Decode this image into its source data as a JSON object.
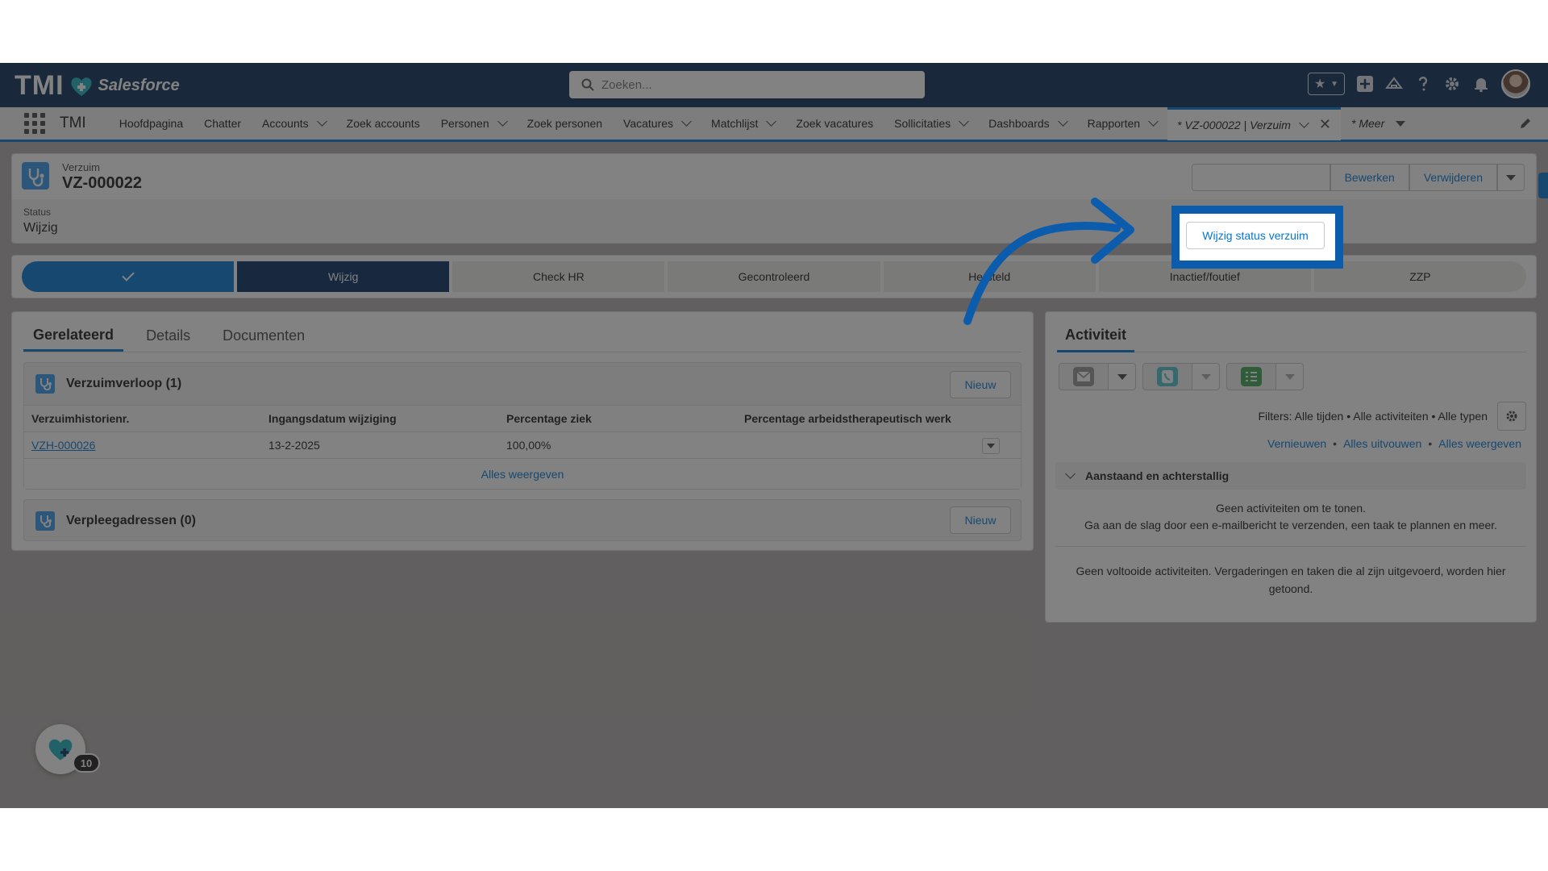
{
  "header": {
    "logo_text": "TMI",
    "brand_text": "Salesforce",
    "search_placeholder": "Zoeken..."
  },
  "nav": {
    "app_name": "TMI",
    "items": [
      {
        "label": "Hoofdpagina",
        "dropdown": false
      },
      {
        "label": "Chatter",
        "dropdown": false
      },
      {
        "label": "Accounts",
        "dropdown": true
      },
      {
        "label": "Zoek accounts",
        "dropdown": false
      },
      {
        "label": "Personen",
        "dropdown": true
      },
      {
        "label": "Zoek personen",
        "dropdown": false
      },
      {
        "label": "Vacatures",
        "dropdown": true
      },
      {
        "label": "Matchlijst",
        "dropdown": true
      },
      {
        "label": "Zoek vacatures",
        "dropdown": false
      },
      {
        "label": "Sollicitaties",
        "dropdown": true
      },
      {
        "label": "Dashboards",
        "dropdown": true
      },
      {
        "label": "Rapporten",
        "dropdown": true
      }
    ],
    "active_tab": "* VZ-000022 | Verzuim",
    "more_label": "* Meer"
  },
  "record": {
    "object_type": "Verzuim",
    "name": "VZ-000022",
    "status_label": "Status",
    "status_value": "Wijzig",
    "buttons": {
      "change_status": "Wijzig status verzuim",
      "edit": "Bewerken",
      "delete": "Verwijderen"
    }
  },
  "path": {
    "steps": [
      {
        "label": "",
        "state": "done"
      },
      {
        "label": "Wijzig",
        "state": "current"
      },
      {
        "label": "Check HR",
        "state": "todo"
      },
      {
        "label": "Gecontroleerd",
        "state": "todo"
      },
      {
        "label": "Hersteld",
        "state": "todo"
      },
      {
        "label": "Inactief/foutief",
        "state": "todo"
      },
      {
        "label": "ZZP",
        "state": "todo"
      }
    ]
  },
  "related": {
    "tabs": [
      "Gerelateerd",
      "Details",
      "Documenten"
    ],
    "history": {
      "title": "Verzuimverloop (1)",
      "new_label": "Nieuw",
      "columns": [
        "Verzuimhistorienr.",
        "Ingangsdatum wijziging",
        "Percentage ziek",
        "Percentage arbeidstherapeutisch werk"
      ],
      "rows": [
        [
          "VZH-000026",
          "13-2-2025",
          "100,00%",
          ""
        ]
      ],
      "view_all": "Alles weergeven"
    },
    "nursing": {
      "title": "Verpleegadressen (0)",
      "new_label": "Nieuw"
    }
  },
  "activity": {
    "title": "Activiteit",
    "filters": "Filters: Alle tijden • Alle activiteiten • Alle typen",
    "links": [
      "Vernieuwen",
      "Alles uitvouwen",
      "Alles weergeven"
    ],
    "upcoming_title": "Aanstaand en achterstallig",
    "empty_line1": "Geen activiteiten om te tonen.",
    "empty_line2": "Ga aan de slag door een e-mailbericht te verzenden, een taak te plannen en meer.",
    "done_empty": "Geen voltooide activiteiten. Vergaderingen en taken die al zijn uitgevoerd, worden hier getoond."
  },
  "utility": {
    "badge": "10"
  },
  "colors": {
    "header_bg": "#062a53",
    "accent": "#0176d3",
    "highlight": "#0b5cad",
    "path_current": "#032d60"
  }
}
